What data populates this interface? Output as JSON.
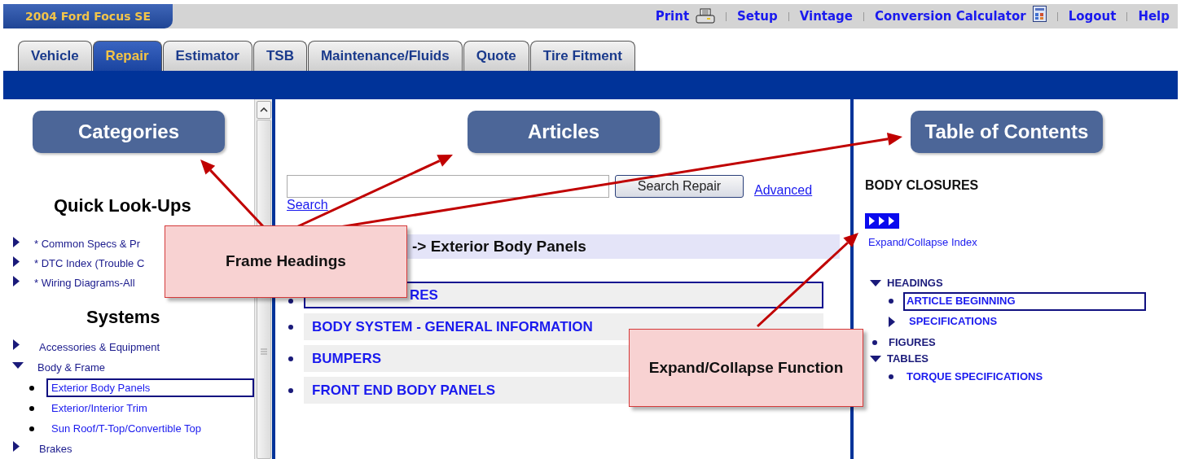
{
  "top_bar": {
    "vehicle": "2004 Ford Focus SE",
    "links": [
      {
        "label": "Print",
        "kind": "printer"
      },
      {
        "label": "Setup",
        "kind": "plain"
      },
      {
        "label": "Vintage",
        "kind": "plain"
      },
      {
        "label": "Conversion Calculator",
        "kind": "calculator"
      },
      {
        "label": "Logout",
        "kind": "plain"
      },
      {
        "label": "Help",
        "kind": "plain"
      }
    ]
  },
  "tabs": [
    {
      "label": "Vehicle",
      "selected": false
    },
    {
      "label": "Repair",
      "selected": true
    },
    {
      "label": "Estimator",
      "selected": false
    },
    {
      "label": "TSB",
      "selected": false
    },
    {
      "label": "Maintenance/Fluids",
      "selected": false
    },
    {
      "label": "Quote",
      "selected": false
    },
    {
      "label": "Tire Fitment",
      "selected": false
    }
  ],
  "categories": {
    "heading": "Categories",
    "quick_lookups": {
      "title": "Quick Look-Ups",
      "items": [
        {
          "label": "* Common Specs & Pr",
          "expanded": false
        },
        {
          "label": "* DTC Index (Trouble C",
          "expanded": false
        },
        {
          "label": "* Wiring Diagrams-All",
          "expanded": false
        }
      ]
    },
    "systems": {
      "title": "Systems",
      "items": [
        {
          "label": "Accessories & Equipment",
          "expanded": false
        },
        {
          "label": "Body & Frame",
          "expanded": true,
          "children": [
            {
              "label": "Exterior Body Panels",
              "selected": true
            },
            {
              "label": "Exterior/Interior Trim",
              "selected": false
            },
            {
              "label": "Sun Roof/T-Top/Convertible Top",
              "selected": false
            }
          ]
        },
        {
          "label": "Brakes",
          "expanded": false
        }
      ]
    }
  },
  "articles": {
    "heading": "Articles",
    "search": {
      "button": "Search Repair",
      "advanced_link": "Advanced",
      "advanced_link_wrap": "Search"
    },
    "breadcrumb": "-> Exterior Body Panels",
    "items": [
      {
        "label": "RES",
        "selected": true
      },
      {
        "label": "BODY SYSTEM - GENERAL INFORMATION",
        "selected": false
      },
      {
        "label": "BUMPERS",
        "selected": false
      },
      {
        "label": "FRONT END BODY PANELS",
        "selected": false
      }
    ]
  },
  "table_of_contents": {
    "heading": "Table of Contents",
    "title": "BODY CLOSURES",
    "expand_link": "Expand/Collapse Index",
    "tree": [
      {
        "label": "HEADINGS",
        "expanded": true,
        "children": [
          {
            "label": "ARTICLE BEGINNING",
            "selected": true
          },
          {
            "label": "SPECIFICATIONS",
            "expanded": false,
            "selected": false
          }
        ]
      },
      {
        "label": "FIGURES"
      },
      {
        "label": "TABLES",
        "expanded": true,
        "children": [
          {
            "label": "TORQUE SPECIFICATIONS",
            "selected": false
          }
        ]
      }
    ]
  },
  "callouts": [
    {
      "text": "Frame Headings"
    },
    {
      "text": "Expand/Collapse Function"
    }
  ]
}
